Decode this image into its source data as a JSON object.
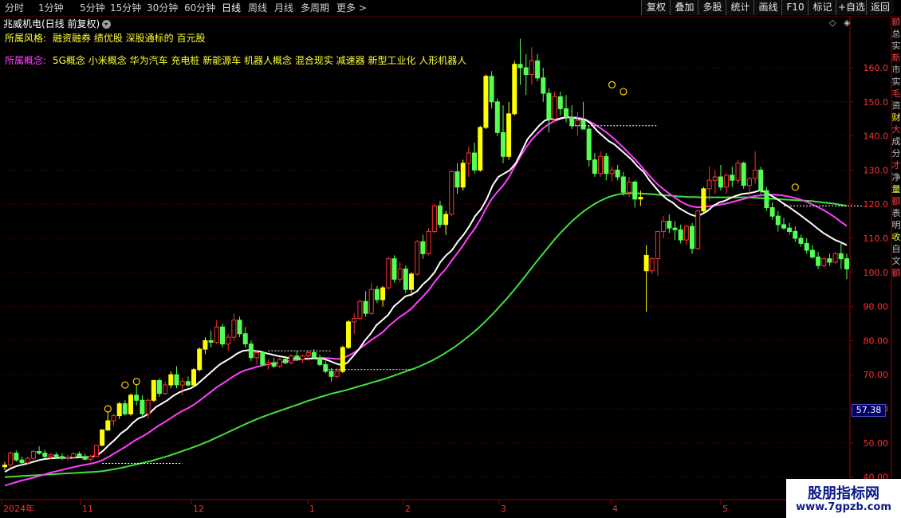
{
  "toolbar": {
    "periods": [
      "分时",
      "1分钟",
      "5分钟",
      "15分钟",
      "30分钟",
      "60分钟",
      "日线",
      "周线",
      "月线",
      "多周期",
      "更多 >"
    ],
    "active_period": "日线",
    "buttons": [
      "复权",
      "叠加",
      "多股",
      "统计",
      "画线",
      "F10",
      "标记",
      "+自选",
      "返回"
    ]
  },
  "stock": {
    "title": "兆威机电(日线 前复权)"
  },
  "info": {
    "style_label": "所属风格:",
    "style_value": "融资融券 绩优股 深股通标的 百元股",
    "concept_label": "所属概念:",
    "concept_value": "5G概念 小米概念 华为汽车 充电桩 新能源车 机器人概念 混合现实 减速器 新型工业化 人形机器人"
  },
  "price_axis": {
    "ticks": [
      "160.0",
      "150.0",
      "140.0",
      "130.0",
      "120.0",
      "110.0",
      "100.0",
      "90.00",
      "80.00",
      "70.00",
      "60.00",
      "50.00",
      "40.00"
    ],
    "current_price": "57.38"
  },
  "date_axis": {
    "labels": [
      "2024年",
      "11",
      "12",
      "1",
      "2",
      "3",
      "4",
      "5"
    ]
  },
  "watermark": {
    "title": "股朋指标网",
    "url": "www.7gpzb.com"
  },
  "right_strip": {
    "chars": [
      "额",
      "总",
      "实",
      "新",
      "市",
      "实",
      "毛",
      "资",
      "财",
      "大",
      "成",
      "分",
      "才",
      "净",
      "量",
      "额",
      "表",
      "明",
      "收",
      "自",
      "文",
      "额"
    ]
  },
  "chart_data": {
    "type": "candlestick",
    "ylim": [
      40,
      170
    ],
    "colors": {
      "up": "#ff3232",
      "down": "#54ff54",
      "limit_up": "#ffff00",
      "ma_white": "#ffffff",
      "ma_magenta": "#ff40ff",
      "ma_green": "#40e040",
      "grid": "#7a0000"
    },
    "candles": [
      [
        43.0,
        44.5,
        42.0,
        43.5
      ],
      [
        43.5,
        47.5,
        43.0,
        47.0
      ],
      [
        47.0,
        47.8,
        44.5,
        45.0
      ],
      [
        45.0,
        46.0,
        43.5,
        44.2
      ],
      [
        44.2,
        46.0,
        43.8,
        45.5
      ],
      [
        45.5,
        48.0,
        45.0,
        47.5
      ],
      [
        47.5,
        49.0,
        46.5,
        47.0
      ],
      [
        47.0,
        48.0,
        45.5,
        46.0
      ],
      [
        46.0,
        47.0,
        45.2,
        46.5
      ],
      [
        46.5,
        47.2,
        45.5,
        46.0
      ],
      [
        46.0,
        47.0,
        45.0,
        45.5
      ],
      [
        45.5,
        46.5,
        44.8,
        45.8
      ],
      [
        45.8,
        47.2,
        45.5,
        46.8
      ],
      [
        46.8,
        47.5,
        45.5,
        46.0
      ],
      [
        46.0,
        46.8,
        45.0,
        45.2
      ],
      [
        45.2,
        46.5,
        44.5,
        46.0
      ],
      [
        46.0,
        49.5,
        45.8,
        49.3
      ],
      [
        49.3,
        54.0,
        49.0,
        53.8
      ],
      [
        53.8,
        59.0,
        53.5,
        56.5
      ],
      [
        56.5,
        58.5,
        55.0,
        58.0
      ],
      [
        58.0,
        62.0,
        57.0,
        61.5
      ],
      [
        61.5,
        62.5,
        58.0,
        58.5
      ],
      [
        58.5,
        64.5,
        58.0,
        64.0
      ],
      [
        64.0,
        67.0,
        61.0,
        62.5
      ],
      [
        62.5,
        64.0,
        57.5,
        58.5
      ],
      [
        58.5,
        63.0,
        57.0,
        62.5
      ],
      [
        62.5,
        68.5,
        62.0,
        68.3
      ],
      [
        68.3,
        69.0,
        63.5,
        64.5
      ],
      [
        64.5,
        68.0,
        64.0,
        67.0
      ],
      [
        67.0,
        71.0,
        66.0,
        70.0
      ],
      [
        70.0,
        72.5,
        66.0,
        67.0
      ],
      [
        67.0,
        69.0,
        64.0,
        68.0
      ],
      [
        68.0,
        69.5,
        66.5,
        67.0
      ],
      [
        67.0,
        72.0,
        66.5,
        71.5
      ],
      [
        71.5,
        78.0,
        71.0,
        77.5
      ],
      [
        77.5,
        81.0,
        76.0,
        80.0
      ],
      [
        80.0,
        83.0,
        78.0,
        79.5
      ],
      [
        79.5,
        86.0,
        79.0,
        84.0
      ],
      [
        84.0,
        85.0,
        78.0,
        79.0
      ],
      [
        79.0,
        82.0,
        77.0,
        81.0
      ],
      [
        81.0,
        88.0,
        80.0,
        86.0
      ],
      [
        86.0,
        87.0,
        81.0,
        82.0
      ],
      [
        82.0,
        84.0,
        78.0,
        79.0
      ],
      [
        79.0,
        80.0,
        74.0,
        75.0
      ],
      [
        75.0,
        77.0,
        73.0,
        76.5
      ],
      [
        76.5,
        77.0,
        72.5,
        73.0
      ],
      [
        73.0,
        74.5,
        71.5,
        73.5
      ],
      [
        73.5,
        75.0,
        72.0,
        72.5
      ],
      [
        72.5,
        75.0,
        72.0,
        74.5
      ],
      [
        74.5,
        75.5,
        73.0,
        73.5
      ],
      [
        73.5,
        76.0,
        73.0,
        75.5
      ],
      [
        75.5,
        77.0,
        74.0,
        74.5
      ],
      [
        74.5,
        76.0,
        73.5,
        75.5
      ],
      [
        75.5,
        77.0,
        74.0,
        76.5
      ],
      [
        76.5,
        77.5,
        74.5,
        75.0
      ],
      [
        75.0,
        76.0,
        72.5,
        73.0
      ],
      [
        73.0,
        74.0,
        70.5,
        71.0
      ],
      [
        71.0,
        72.0,
        68.0,
        69.5
      ],
      [
        69.5,
        72.0,
        69.0,
        71.0
      ],
      [
        71.0,
        78.5,
        70.5,
        78.0
      ],
      [
        78.0,
        86.0,
        77.5,
        85.5
      ],
      [
        85.5,
        88.0,
        82.0,
        86.5
      ],
      [
        86.5,
        92.0,
        86.0,
        91.5
      ],
      [
        91.5,
        94.5,
        87.0,
        88.0
      ],
      [
        88.0,
        97.0,
        87.5,
        95.0
      ],
      [
        95.0,
        96.0,
        91.0,
        92.0
      ],
      [
        92.0,
        96.0,
        90.0,
        95.5
      ],
      [
        95.5,
        104.5,
        95.0,
        104.0
      ],
      [
        104.0,
        105.0,
        97.0,
        98.0
      ],
      [
        98.0,
        103.0,
        97.0,
        101.0
      ],
      [
        101.0,
        102.0,
        94.0,
        95.0
      ],
      [
        95.0,
        100.0,
        93.0,
        99.5
      ],
      [
        99.5,
        109.5,
        99.0,
        109.0
      ],
      [
        109.0,
        111.0,
        104.0,
        105.5
      ],
      [
        105.5,
        113.0,
        105.0,
        112.0
      ],
      [
        112.0,
        120.0,
        111.5,
        119.5
      ],
      [
        119.5,
        121.0,
        113.0,
        114.0
      ],
      [
        114.0,
        118.0,
        111.0,
        117.0
      ],
      [
        117.0,
        130.0,
        116.5,
        129.5
      ],
      [
        129.5,
        132.0,
        123.0,
        125.0
      ],
      [
        125.0,
        133.0,
        124.0,
        132.0
      ],
      [
        132.0,
        137.0,
        128.0,
        135.0
      ],
      [
        135.0,
        138.0,
        129.0,
        130.0
      ],
      [
        130.0,
        143.0,
        129.5,
        142.5
      ],
      [
        142.5,
        158.0,
        142.0,
        157.5
      ],
      [
        157.5,
        159.0,
        148.0,
        150.0
      ],
      [
        150.0,
        151.0,
        140.0,
        141.0
      ],
      [
        141.0,
        149.0,
        132.0,
        134.0
      ],
      [
        134.0,
        150.0,
        133.0,
        146.5
      ],
      [
        146.5,
        162.0,
        146.0,
        161.0
      ],
      [
        161.0,
        168.5,
        155.0,
        160.0
      ],
      [
        160.0,
        164.0,
        152.0,
        158.0
      ],
      [
        158.0,
        166.0,
        155.0,
        162.0
      ],
      [
        162.0,
        164.0,
        156.0,
        157.0
      ],
      [
        157.0,
        160.0,
        150.0,
        152.5
      ],
      [
        152.5,
        154.0,
        141.0,
        145.0
      ],
      [
        145.0,
        153.0,
        144.0,
        151.5
      ],
      [
        151.5,
        153.0,
        146.0,
        148.0
      ],
      [
        148.0,
        152.0,
        144.0,
        145.5
      ],
      [
        145.5,
        149.0,
        142.0,
        143.0
      ],
      [
        143.0,
        147.0,
        140.0,
        144.5
      ],
      [
        144.5,
        150.0,
        143.0,
        142.0
      ],
      [
        142.0,
        143.0,
        131.0,
        133.0
      ],
      [
        133.0,
        135.0,
        128.0,
        129.0
      ],
      [
        129.0,
        135.5,
        128.0,
        134.0
      ],
      [
        134.0,
        135.0,
        127.0,
        129.0
      ],
      [
        129.0,
        131.0,
        126.5,
        130.0
      ],
      [
        130.0,
        131.5,
        127.0,
        128.0
      ],
      [
        128.0,
        129.5,
        122.5,
        123.5
      ],
      [
        123.5,
        128.0,
        122.0,
        126.5
      ],
      [
        126.5,
        127.0,
        119.0,
        121.5
      ],
      [
        121.5,
        124.0,
        119.5,
        122.0
      ],
      [
        105.0,
        108.0,
        88.5,
        100.5
      ],
      [
        100.5,
        104.5,
        99.5,
        104.0
      ],
      [
        104.0,
        112.0,
        99.0,
        112.0
      ],
      [
        112.0,
        116.5,
        110.0,
        115.0
      ],
      [
        115.0,
        117.0,
        111.5,
        113.0
      ],
      [
        113.0,
        115.0,
        109.5,
        112.5
      ],
      [
        112.5,
        114.0,
        108.5,
        109.5
      ],
      [
        109.5,
        114.0,
        108.0,
        113.5
      ],
      [
        113.5,
        114.5,
        105.5,
        107.0
      ],
      [
        107.0,
        118.5,
        106.5,
        118.0
      ],
      [
        118.0,
        125.0,
        117.5,
        124.5
      ],
      [
        124.5,
        131.0,
        121.0,
        127.0
      ],
      [
        127.0,
        130.0,
        123.0,
        128.0
      ],
      [
        128.0,
        131.5,
        124.0,
        125.0
      ],
      [
        125.0,
        129.0,
        123.0,
        128.5
      ],
      [
        128.5,
        131.0,
        125.0,
        127.0
      ],
      [
        127.0,
        133.0,
        126.0,
        132.0
      ],
      [
        132.0,
        132.5,
        124.5,
        125.5
      ],
      [
        125.5,
        128.0,
        122.0,
        127.5
      ],
      [
        127.5,
        135.5,
        126.0,
        130.0
      ],
      [
        130.0,
        131.0,
        123.0,
        124.0
      ],
      [
        124.0,
        125.0,
        118.0,
        119.0
      ],
      [
        119.0,
        120.5,
        115.5,
        116.5
      ],
      [
        116.5,
        118.0,
        112.0,
        114.0
      ],
      [
        114.0,
        116.0,
        112.5,
        113.0
      ],
      [
        113.0,
        114.5,
        111.0,
        112.0
      ],
      [
        112.0,
        113.5,
        109.0,
        110.0
      ],
      [
        110.0,
        111.0,
        107.5,
        108.5
      ],
      [
        108.5,
        110.0,
        105.5,
        106.5
      ],
      [
        106.5,
        108.0,
        104.0,
        104.5
      ],
      [
        104.5,
        106.0,
        101.0,
        102.0
      ],
      [
        102.0,
        104.5,
        101.5,
        104.0
      ],
      [
        104.0,
        105.5,
        102.0,
        103.0
      ],
      [
        103.0,
        106.0,
        102.5,
        105.5
      ],
      [
        105.5,
        109.0,
        101.0,
        104.0
      ],
      [
        104.0,
        105.5,
        98.0,
        101.0
      ]
    ],
    "limit_up_dates": [
      0,
      17,
      18,
      20,
      22,
      26,
      29,
      33,
      34,
      35,
      59,
      60,
      66,
      71,
      77,
      80,
      83,
      84,
      88,
      89,
      111,
      112,
      122
    ],
    "ma_white": [
      41.5,
      42.5,
      43.2,
      43.6,
      44.0,
      44.5,
      45.0,
      45.3,
      45.5,
      45.6,
      45.6,
      45.6,
      45.7,
      45.8,
      45.8,
      45.9,
      46.5,
      47.8,
      49.5,
      51.0,
      52.8,
      54.0,
      55.8,
      57.2,
      57.8,
      58.8,
      60.5,
      61.5,
      62.5,
      63.8,
      64.8,
      65.5,
      66.0,
      67.0,
      68.5,
      70.0,
      71.5,
      73.0,
      74.0,
      75.0,
      76.2,
      77.0,
      77.2,
      77.0,
      76.8,
      76.3,
      75.9,
      75.5,
      75.2,
      74.9,
      74.8,
      74.8,
      74.7,
      74.8,
      74.8,
      74.6,
      74.0,
      73.3,
      72.8,
      73.5,
      75.5,
      77.5,
      80.0,
      82.0,
      84.5,
      86.0,
      87.5,
      90.0,
      91.5,
      93.0,
      93.5,
      94.5,
      96.5,
      98.0,
      100.0,
      103.0,
      105.0,
      106.5,
      109.0,
      111.0,
      113.5,
      116.5,
      118.5,
      121.5,
      125.5,
      128.0,
      129.0,
      130.0,
      132.0,
      135.5,
      139.0,
      141.0,
      143.0,
      144.5,
      145.0,
      144.8,
      145.3,
      145.5,
      145.3,
      145.0,
      144.8,
      143.5,
      141.5,
      140.0,
      138.5,
      137.5,
      136.0,
      134.5,
      133.0,
      131.0,
      129.5,
      127.0,
      125.0,
      123.0,
      121.5,
      120.5,
      119.0,
      118.0,
      117.0,
      116.5,
      117.0,
      118.0,
      119.5,
      120.5,
      121.0,
      121.8,
      122.5,
      123.0,
      123.2,
      123.5,
      124.0,
      123.5,
      122.5,
      121.5,
      120.3,
      119.2,
      118.0,
      116.8,
      115.5,
      114.2,
      112.8,
      111.5,
      110.5,
      109.5,
      108.8,
      108.0
    ],
    "ma_magenta": [
      37.5,
      38.0,
      38.5,
      39.0,
      39.4,
      39.8,
      40.3,
      40.8,
      41.3,
      41.7,
      42.1,
      42.5,
      42.9,
      43.3,
      43.6,
      43.9,
      44.3,
      44.9,
      45.8,
      46.8,
      47.8,
      48.8,
      49.9,
      51.0,
      51.9,
      52.9,
      54.1,
      55.2,
      56.2,
      57.3,
      58.4,
      59.4,
      60.2,
      61.2,
      62.4,
      63.7,
      65.0,
      66.3,
      67.4,
      68.5,
      69.6,
      70.6,
      71.3,
      71.8,
      72.3,
      72.7,
      73.1,
      73.4,
      73.6,
      73.9,
      74.2,
      74.4,
      74.5,
      74.7,
      74.8,
      74.9,
      74.9,
      74.8,
      74.6,
      74.8,
      75.6,
      76.5,
      77.7,
      78.9,
      80.2,
      81.3,
      82.5,
      84.2,
      85.6,
      87.0,
      88.1,
      89.4,
      91.2,
      92.9,
      94.8,
      97.1,
      99.2,
      101.0,
      103.4,
      105.6,
      107.9,
      110.5,
      112.7,
      115.4,
      118.7,
      121.5,
      123.6,
      125.5,
      127.9,
      130.9,
      133.9,
      136.6,
      138.9,
      140.7,
      142.3,
      143.5,
      144.4,
      145.0,
      145.4,
      145.5,
      145.4,
      145.0,
      144.3,
      143.4,
      142.3,
      141.1,
      139.7,
      138.2,
      136.6,
      134.9,
      133.2,
      131.3,
      129.4,
      127.5,
      125.8,
      124.4,
      123.1,
      121.9,
      120.8,
      119.9,
      119.3,
      119.1,
      119.2,
      119.4,
      119.6,
      119.9,
      120.2,
      120.6,
      121.1,
      121.5,
      122.0,
      122.4,
      122.6,
      122.8,
      122.8,
      122.7,
      122.5,
      122.2,
      121.8,
      121.3,
      120.7,
      119.9,
      119.1,
      118.2,
      117.2,
      116.1,
      114.8,
      113.6
    ],
    "ma_green": [
      40.0,
      40.1,
      40.2,
      40.3,
      40.4,
      40.5,
      40.6,
      40.7,
      40.8,
      40.9,
      41.0,
      41.1,
      41.2,
      41.3,
      41.4,
      41.5,
      41.6,
      41.8,
      42.1,
      42.4,
      42.7,
      43.1,
      43.5,
      43.9,
      44.3,
      44.7,
      45.2,
      45.7,
      46.2,
      46.8,
      47.4,
      48.0,
      48.6,
      49.2,
      49.9,
      50.6,
      51.4,
      52.2,
      53.0,
      53.8,
      54.6,
      55.4,
      56.2,
      56.9,
      57.6,
      58.2,
      58.8,
      59.4,
      60.0,
      60.6,
      61.2,
      61.8,
      62.4,
      62.9,
      63.5,
      64.0,
      64.5,
      64.9,
      65.3,
      65.8,
      66.3,
      66.8,
      67.3,
      67.8,
      68.3,
      68.8,
      69.4,
      70.0,
      70.6,
      71.2,
      71.8,
      72.5,
      73.3,
      74.1,
      75.0,
      76.0,
      77.1,
      78.2,
      79.5,
      80.8,
      82.2,
      83.7,
      85.3,
      87.0,
      88.8,
      90.7,
      92.6,
      94.6,
      96.7,
      98.9,
      101.1,
      103.3,
      105.4,
      107.5,
      109.6,
      111.5,
      113.3,
      115.0,
      116.5,
      117.9,
      119.1,
      120.2,
      121.1,
      121.9,
      122.5,
      122.9,
      123.1,
      123.2,
      123.2,
      123.1,
      123.0,
      122.9,
      122.7,
      122.6,
      122.5,
      122.3,
      122.2,
      122.1,
      122.1,
      122.0,
      122.0,
      122.0,
      122.0,
      122.0,
      122.0,
      122.0,
      122.0,
      122.0,
      121.9,
      121.8,
      121.7,
      121.6,
      121.5,
      121.4,
      121.3,
      121.2,
      121.1,
      121.0,
      120.9,
      120.7,
      120.5,
      120.3,
      120.1,
      119.8,
      119.5
    ]
  }
}
